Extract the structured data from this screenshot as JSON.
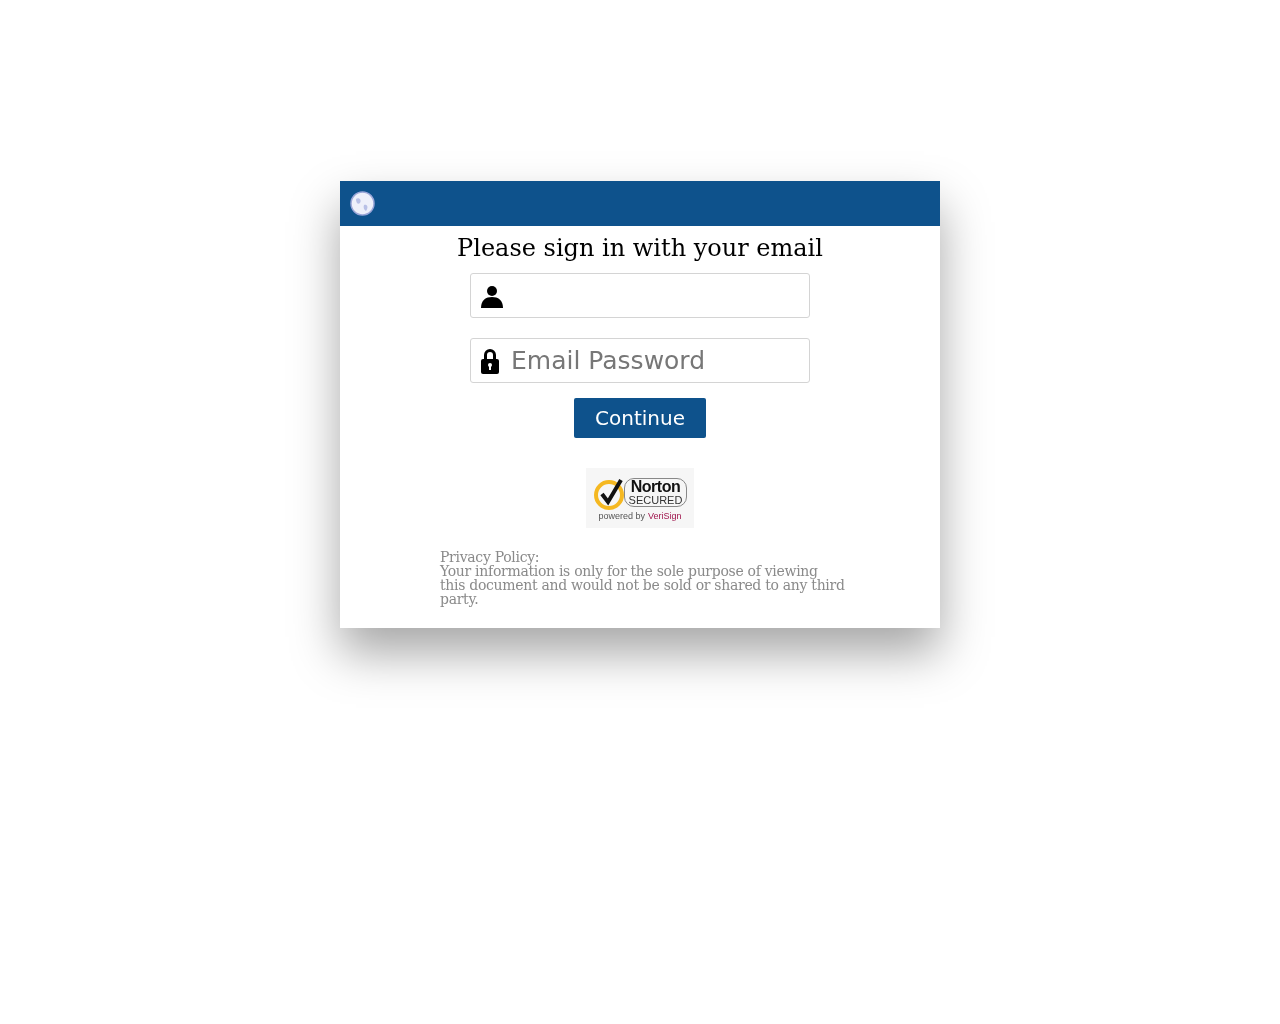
{
  "title": "Please sign in with your email",
  "fields": [
    {
      "kind": "user"
    },
    {
      "kind": "lock",
      "placeholder": "Email Password"
    }
  ],
  "button": "Continue",
  "badge": {
    "brand": "Norton",
    "status": "SECURED",
    "powered": "powered by",
    "partner": "VeriSign"
  },
  "privacy": {
    "heading": "Privacy Policy:",
    "text": "Your information is only for the sole purpose of viewing this document and would not be sold or shared to any third party."
  }
}
